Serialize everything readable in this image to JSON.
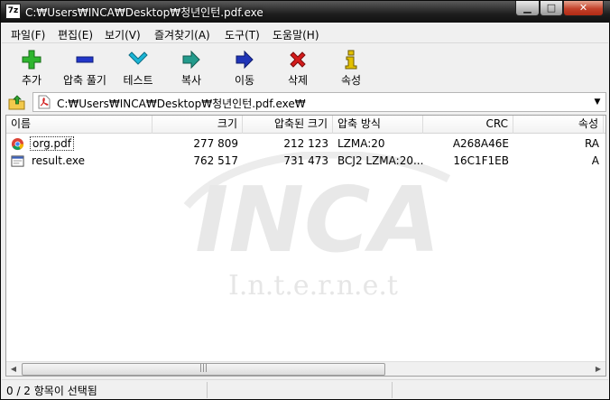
{
  "window": {
    "title": "C:₩Users₩INCA₩Desktop₩청년인턴.pdf.exe",
    "app_icon_text": "7z",
    "min_glyph": "▁",
    "max_glyph": "□",
    "close_glyph": "✕"
  },
  "menu": [
    {
      "label": "파일(F)"
    },
    {
      "label": "편집(E)"
    },
    {
      "label": "보기(V)"
    },
    {
      "label": "즐겨찾기(A)"
    },
    {
      "label": "도구(T)"
    },
    {
      "label": "도움말(H)"
    }
  ],
  "toolbar": [
    {
      "label": "추가",
      "icon": "plus-icon",
      "color": "#1f9e1f"
    },
    {
      "label": "압축 풀기",
      "icon": "minus-icon",
      "color": "#1a2fb8"
    },
    {
      "label": "테스트",
      "icon": "check-icon",
      "color": "#17a9c9"
    },
    {
      "label": "복사",
      "icon": "copy-arrow-icon",
      "color": "#1d8c7e"
    },
    {
      "label": "이동",
      "icon": "move-arrow-icon",
      "color": "#1a2faa"
    },
    {
      "label": "삭제",
      "icon": "delete-x-icon",
      "color": "#c81414"
    },
    {
      "label": "속성",
      "icon": "info-icon",
      "color": "#c9a800"
    }
  ],
  "address": {
    "path": "C:₩Users₩INCA₩Desktop₩청년인턴.pdf.exe₩"
  },
  "columns": [
    {
      "label": "이름"
    },
    {
      "label": "크기"
    },
    {
      "label": "압축된 크기"
    },
    {
      "label": "압축 방식"
    },
    {
      "label": "CRC"
    },
    {
      "label": "속성"
    }
  ],
  "files": [
    {
      "name": "org.pdf",
      "icon": "chrome-icon",
      "size": "277 809",
      "packed": "212 123",
      "method": "LZMA:20",
      "crc": "A268A46E",
      "attr": "RA"
    },
    {
      "name": "result.exe",
      "icon": "exe-icon",
      "size": "762 517",
      "packed": "731 473",
      "method": "BCJ2 LZMA:20...",
      "crc": "16C1F1EB",
      "attr": "A"
    }
  ],
  "watermark": {
    "brand": "INCA",
    "tagline": "I.n.t.e.r.n.e.t"
  },
  "status": {
    "text": "0 / 2 항목이 선택됨"
  },
  "colors": {
    "titlebar": "#1e1e1e",
    "close_button": "#c3412a",
    "watermark": "#e6e6e6"
  }
}
